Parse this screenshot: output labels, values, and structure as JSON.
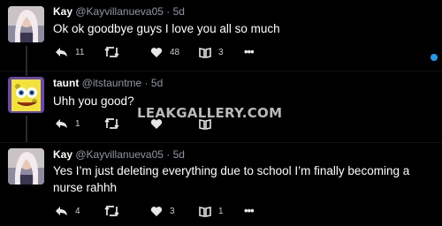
{
  "watermark": "LEAKGALLERY.COM",
  "tweets": [
    {
      "name": "Kay",
      "handle": "@Kayvillanueva05",
      "sep": "·",
      "time": "5d",
      "text": "Ok ok goodbye guys I love you all so much",
      "reply_count": "11",
      "retweet_count": "",
      "like_count": "48",
      "bookmark_count": "3",
      "more": "•••",
      "avatar": "avatar-kay"
    },
    {
      "name": "taunt",
      "handle": "@itstauntme",
      "sep": "·",
      "time": "5d",
      "text": "Uhh you good?",
      "reply_count": "1",
      "retweet_count": "",
      "like_count": "",
      "bookmark_count": "",
      "more": "•••",
      "avatar": "avatar-spongebob"
    },
    {
      "name": "Kay",
      "handle": "@Kayvillanueva05",
      "sep": "·",
      "time": "5d",
      "text": "Yes I’m just deleting everything due to school I’m finally becoming a nurse rahhh",
      "reply_count": "4",
      "retweet_count": "",
      "like_count": "3",
      "bookmark_count": "1",
      "more": "•••",
      "avatar": "avatar-kay"
    }
  ],
  "icons": {
    "reply": "reply-arrow-icon",
    "retweet": "retweet-icon",
    "like": "heart-icon",
    "bookmark": "book-icon",
    "more": "more-dots-icon"
  },
  "colors": {
    "background": "#000000",
    "secondary_text": "#8b98a5",
    "accent": "#1d9bf0"
  }
}
